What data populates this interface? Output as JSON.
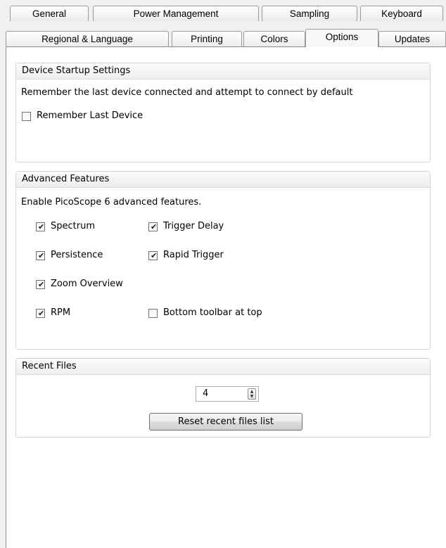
{
  "tabs_row1": [
    {
      "label": "General"
    },
    {
      "label": "Power Management"
    },
    {
      "label": "Sampling"
    },
    {
      "label": "Keyboard"
    }
  ],
  "tabs_row2": [
    {
      "label": "Regional & Language"
    },
    {
      "label": "Printing"
    },
    {
      "label": "Colors"
    },
    {
      "label": "Options",
      "active": true
    },
    {
      "label": "Updates"
    }
  ],
  "device_startup": {
    "header": "Device Startup Settings",
    "description": "Remember the last device connected and attempt to connect by default",
    "remember_last_device": {
      "label": "Remember Last Device",
      "checked": false
    }
  },
  "advanced": {
    "header": "Advanced Features",
    "description": "Enable PicoScope 6 advanced features.",
    "options": {
      "spectrum": {
        "label": "Spectrum",
        "checked": true
      },
      "trigger_delay": {
        "label": "Trigger Delay",
        "checked": true
      },
      "persistence": {
        "label": "Persistence",
        "checked": true
      },
      "rapid_trigger": {
        "label": "Rapid Trigger",
        "checked": true
      },
      "zoom_overview": {
        "label": "Zoom Overview",
        "checked": true
      },
      "rpm": {
        "label": "RPM",
        "checked": true
      },
      "bottom_toolbar": {
        "label": "Bottom toolbar at top",
        "checked": false
      }
    }
  },
  "recent_files": {
    "header": "Recent Files",
    "count_value": "4",
    "reset_button": "Reset recent files list"
  },
  "icons": {
    "checkmark": "✔",
    "spin_up": "▲",
    "spin_down": "▼"
  }
}
